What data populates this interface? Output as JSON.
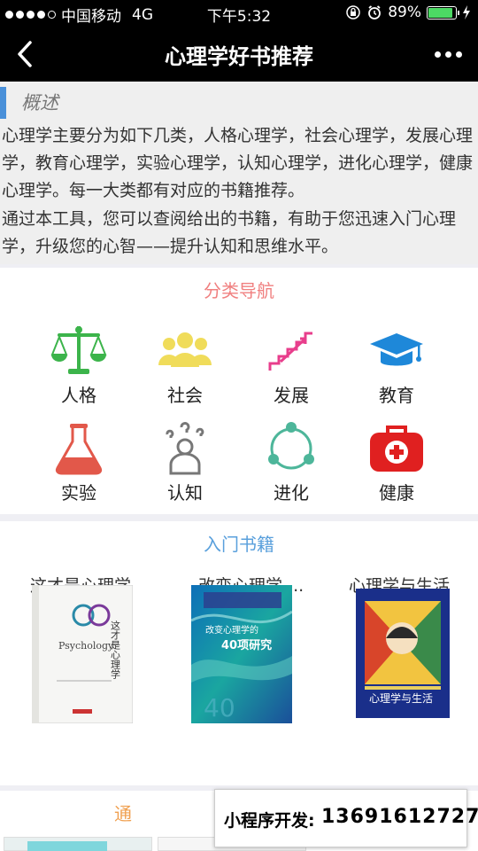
{
  "status": {
    "carrier": "中国移动",
    "network": "4G",
    "time": "下午5:32",
    "battery": "89%",
    "battery_level": 0.89
  },
  "nav": {
    "title": "心理学好书推荐"
  },
  "overview": {
    "heading": "概述",
    "p1": "心理学主要分为如下几类，人格心理学，社会心理学，发展心理学，教育心理学，实验心理学，认知心理学，进化心理学，健康心理学。每一大类都有对应的书籍推荐。",
    "p2": "通过本工具，您可以查阅给出的书籍，有助于您迅速入门心理学，升级您的心智——提升认知和思维水平。"
  },
  "categories": {
    "title": "分类导航",
    "items": [
      {
        "label": "人格",
        "icon": "scale-icon",
        "color": "#3cb44b"
      },
      {
        "label": "社会",
        "icon": "group-icon",
        "color": "#f0dc5a"
      },
      {
        "label": "发展",
        "icon": "stairs-icon",
        "color": "#e83e8c"
      },
      {
        "label": "教育",
        "icon": "graduation-cap-icon",
        "color": "#1e88d9"
      },
      {
        "label": "实验",
        "icon": "flask-icon",
        "color": "#e2584a"
      },
      {
        "label": "认知",
        "icon": "thinking-person-icon",
        "color": "#777777"
      },
      {
        "label": "进化",
        "icon": "cycle-icon",
        "color": "#4db69a"
      },
      {
        "label": "健康",
        "icon": "first-aid-icon",
        "color": "#e02020"
      }
    ]
  },
  "books": {
    "title": "入门书籍",
    "items": [
      {
        "title": "这才是心理学",
        "cover_title": "这才是心理学",
        "cover_sub": "Psychology"
      },
      {
        "title": "改变心理学....",
        "cover_title": "40项研究",
        "cover_sub": "改变心理学的"
      },
      {
        "title": "心理学与生活",
        "cover_title": "心理学与生活",
        "cover_sub": ""
      }
    ]
  },
  "more_section": {
    "title_fragment": "通"
  },
  "ad": {
    "label": "小程序开发:",
    "phone": "13691612727"
  }
}
